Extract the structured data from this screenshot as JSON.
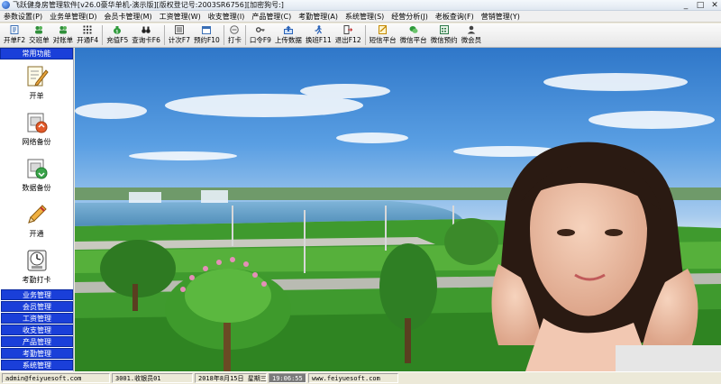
{
  "window": {
    "title": "飞跃健身房管理软件[v26.0豪华单机-演示版][版权登记号:2003SR6756][加密狗号:]",
    "controls": [
      "_",
      "□",
      "✕"
    ]
  },
  "menu": [
    {
      "label": "参数设置(P)"
    },
    {
      "label": "业务单管理(D)"
    },
    {
      "label": "会员卡管理(M)"
    },
    {
      "label": "工资管理(W)"
    },
    {
      "label": "收支管理(I)"
    },
    {
      "label": "产品管理(C)"
    },
    {
      "label": "考勤管理(A)"
    },
    {
      "label": "系统管理(S)"
    },
    {
      "label": "经营分析(J)"
    },
    {
      "label": "老板查询(F)"
    },
    {
      "label": "营销管理(Y)"
    }
  ],
  "toolbar": {
    "buttons": [
      {
        "label": "开单F2",
        "icon": "form-icon",
        "color": "#3a6fb5"
      },
      {
        "label": "交班单",
        "icon": "people-icon",
        "color": "#2f8f3a"
      },
      {
        "label": "对账单",
        "icon": "people-icon",
        "color": "#2f8f3a"
      },
      {
        "label": "开通F4",
        "icon": "grid-icon",
        "color": "#3a3a3a"
      },
      {
        "label": "充值F5",
        "icon": "money-bag-icon",
        "color": "#2e9a3a"
      },
      {
        "label": "查询卡F6",
        "icon": "binoculars-icon",
        "color": "#222222"
      },
      {
        "label": "计次F7",
        "icon": "list-icon",
        "color": "#555555"
      },
      {
        "label": "预约F10",
        "icon": "calendar-icon",
        "color": "#3a6fb5"
      },
      {
        "label": "打卡",
        "icon": "clock-icon",
        "color": "#666666"
      },
      {
        "label": "口令F9",
        "icon": "key-icon",
        "color": "#444444"
      },
      {
        "label": "上传数据",
        "icon": "upload-icon",
        "color": "#2a63b8"
      },
      {
        "label": "换班F11",
        "icon": "runner-icon",
        "color": "#2a63b8"
      },
      {
        "label": "退出F12",
        "icon": "exit-door-icon",
        "color": "#444444"
      },
      {
        "label": "短信平台",
        "icon": "sms-icon",
        "color": "#c58a00"
      },
      {
        "label": "微信平台",
        "icon": "wechat-icon",
        "color": "#2e9a3a"
      },
      {
        "label": "微信预约",
        "icon": "wechat-calendar-icon",
        "color": "#2e7a4a"
      },
      {
        "label": "微会员",
        "icon": "member-icon",
        "color": "#444444"
      }
    ]
  },
  "sidebar": {
    "header": "常用功能",
    "items": [
      {
        "label": "开单",
        "icon": "document-pen-icon"
      },
      {
        "label": "网络备份",
        "icon": "network-backup-icon"
      },
      {
        "label": "数据备份",
        "icon": "data-backup-icon"
      },
      {
        "label": "开通",
        "icon": "pen-icon"
      },
      {
        "label": "考勤打卡",
        "icon": "time-clock-icon"
      }
    ],
    "groups": [
      {
        "label": "业务管理"
      },
      {
        "label": "会员管理"
      },
      {
        "label": "工资管理"
      },
      {
        "label": "收支管理"
      },
      {
        "label": "产品管理"
      },
      {
        "label": "考勤管理"
      },
      {
        "label": "系统管理"
      }
    ]
  },
  "statusbar": {
    "email": "admin@feiyuesoft.com",
    "operator": "3001.收银员01",
    "date": "2018年8月15日 星期三",
    "time": "19:06:55",
    "website": "www.feiyuesoft.com"
  },
  "colors": {
    "panel_blue": "#1a3fd9",
    "sky_top": "#2f77c9",
    "grass": "#3f9a2e"
  }
}
